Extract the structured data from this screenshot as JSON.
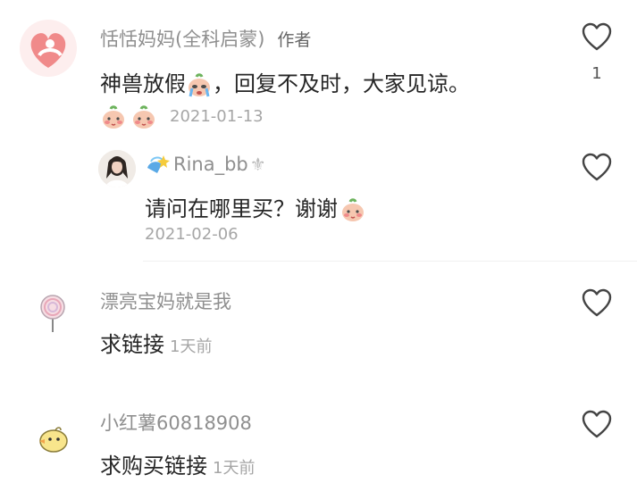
{
  "comments": [
    {
      "username": "恬恬妈妈(全科启蒙)",
      "author_tag": "作者",
      "text_before": "神兽放假",
      "text_after": "，回复不及时，大家见谅。",
      "date": "2021-01-13",
      "likes": "1",
      "reaction_icons": [
        "blushing-peach-emoji",
        "blushing-peach-emoji"
      ],
      "reply": {
        "username": "Rina_bb",
        "text": "请问在哪里买？谢谢",
        "date": "2021-02-06"
      }
    },
    {
      "username": "漂亮宝妈就是我",
      "text": "求链接",
      "time": "1天前"
    },
    {
      "username": "小红薯60818908",
      "text": "求购买链接",
      "time": "1天前"
    }
  ],
  "colors": {
    "username": "#8f8f8f",
    "text": "#262626",
    "meta": "#a6a6a6",
    "heart_outline": "#444444",
    "avatar_brand": "#f08a8a"
  },
  "icons": {
    "like": "heart-outline-icon",
    "verified_badge": "gem-badge-icon",
    "fleur": "fleur-de-lis-icon",
    "crying_emoji": "crying-face-emoji"
  }
}
